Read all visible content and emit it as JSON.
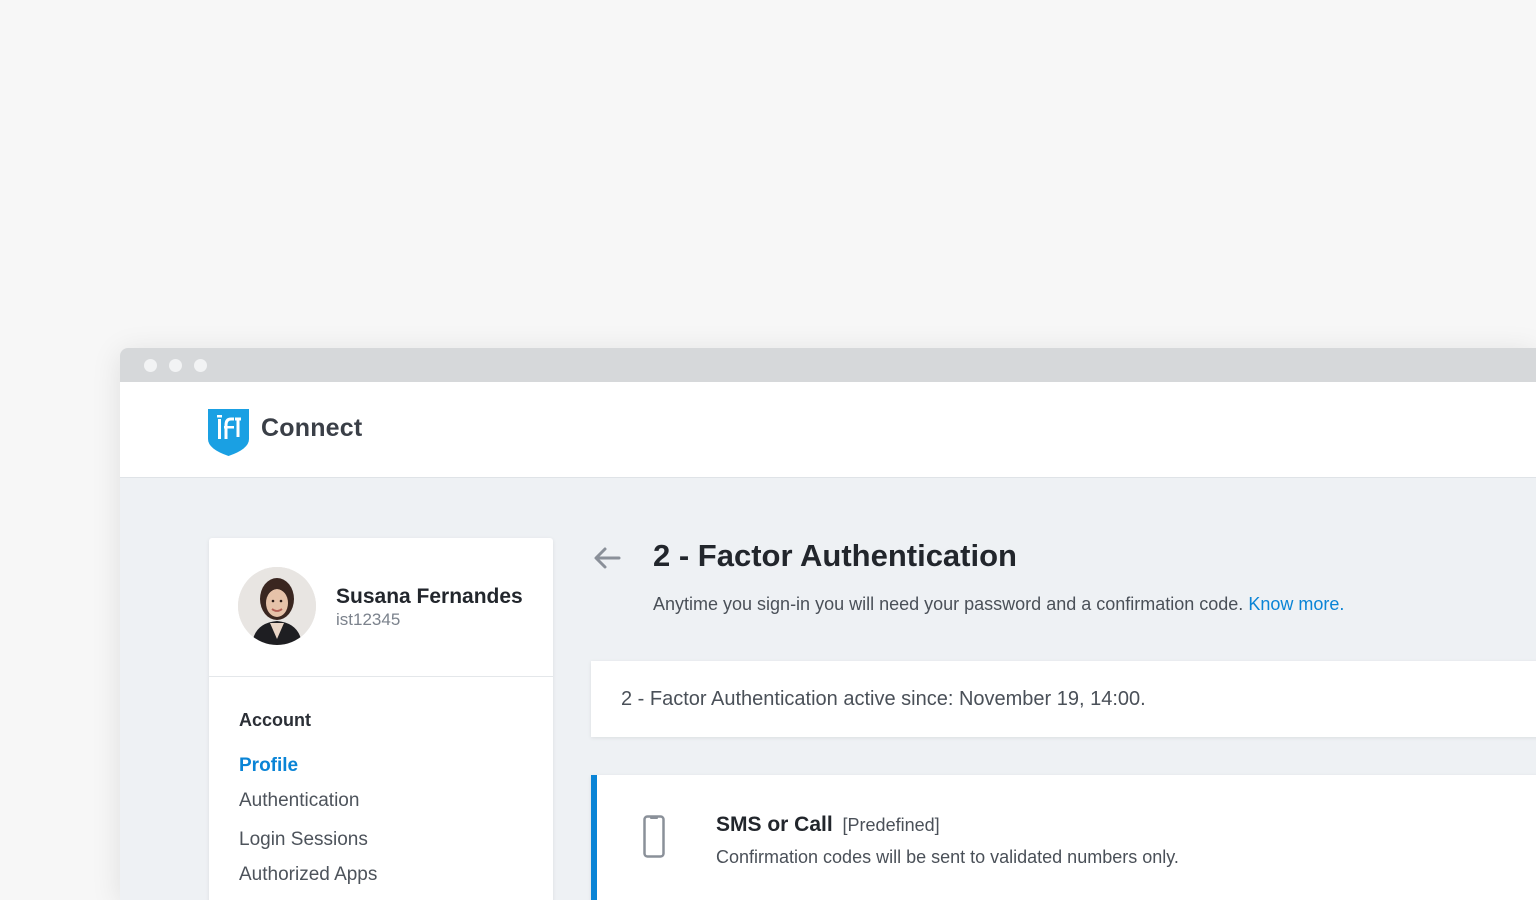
{
  "app": {
    "brand": "Connect",
    "accent_color": "#0a84d6",
    "logo_icon": "ist-shield-logo"
  },
  "user": {
    "name": "Susana Fernandes",
    "id": "ist12345"
  },
  "sidebar": {
    "section_title": "Account",
    "items": [
      {
        "label": "Profile",
        "active": true
      },
      {
        "label": "Authentication",
        "active": false
      },
      {
        "label": "Login Sessions",
        "active": false
      },
      {
        "label": "Authorized Apps",
        "active": false
      }
    ]
  },
  "main": {
    "title": "2 - Factor Authentication",
    "description": "Anytime you sign-in you will need your password and a confirmation code.",
    "know_more": "Know more.",
    "status": "2 - Factor Authentication active since: November 19, 14:00.",
    "method": {
      "title": "SMS or Call",
      "tag": "[Predefined]",
      "description": "Confirmation codes will be sent to validated numbers only.",
      "icon": "phone-icon"
    }
  }
}
